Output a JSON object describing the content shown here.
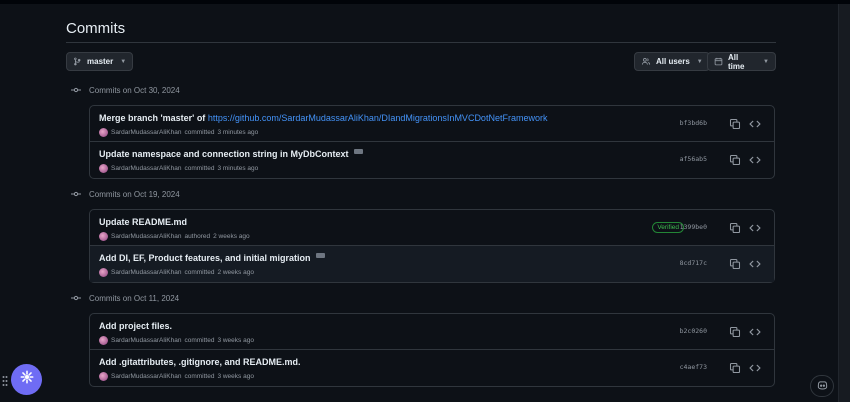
{
  "page": {
    "title": "Commits"
  },
  "controls": {
    "branch": "master",
    "users": "All users",
    "time": "All time"
  },
  "groups": [
    {
      "heading": "Commits on Oct 30, 2024",
      "commits": [
        {
          "msg_prefix": "Merge branch 'master' of ",
          "msg_link": "https://github.com/SardarMudassarAliKhan/DIandMigrationsInMVCDotNetFramework",
          "author": "SardarMudassarAliKhan",
          "action": "committed",
          "time": "3 minutes ago",
          "sha": "bf3bd6b"
        },
        {
          "msg": "Update namespace and connection string in MyDbContext",
          "author": "SardarMudassarAliKhan",
          "action": "committed",
          "time": "3 minutes ago",
          "sha": "af56ab5"
        }
      ]
    },
    {
      "heading": "Commits on Oct 19, 2024",
      "commits": [
        {
          "msg": "Update README.md",
          "author": "SardarMudassarAliKhan",
          "action": "authored",
          "time": "2 weeks ago",
          "sha": "1399be0",
          "badge": "Verified"
        },
        {
          "msg": "Add DI, EF, Product features, and initial migration",
          "author": "SardarMudassarAliKhan",
          "action": "committed",
          "time": "2 weeks ago",
          "sha": "8cd717c"
        }
      ]
    },
    {
      "heading": "Commits on Oct 11, 2024",
      "commits": [
        {
          "msg": "Add project files.",
          "author": "SardarMudassarAliKhan",
          "action": "committed",
          "time": "3 weeks ago",
          "sha": "b2c0260"
        },
        {
          "msg": "Add .gitattributes, .gitignore, and README.md.",
          "author": "SardarMudassarAliKhan",
          "action": "committed",
          "time": "3 weeks ago",
          "sha": "c4aef73"
        }
      ]
    }
  ],
  "icons": {
    "branch": "git-branch-icon",
    "users": "people-icon",
    "time": "calendar-icon",
    "commit": "git-commit-icon",
    "copy": "copy-icon",
    "browse": "code-icon",
    "fab": "spark-icon",
    "copilot": "copilot-icon",
    "grip": "grip-icon"
  },
  "colors": {
    "accent": "#4493f8",
    "verified": "#3fb950",
    "fab": "#6f6cf4"
  }
}
